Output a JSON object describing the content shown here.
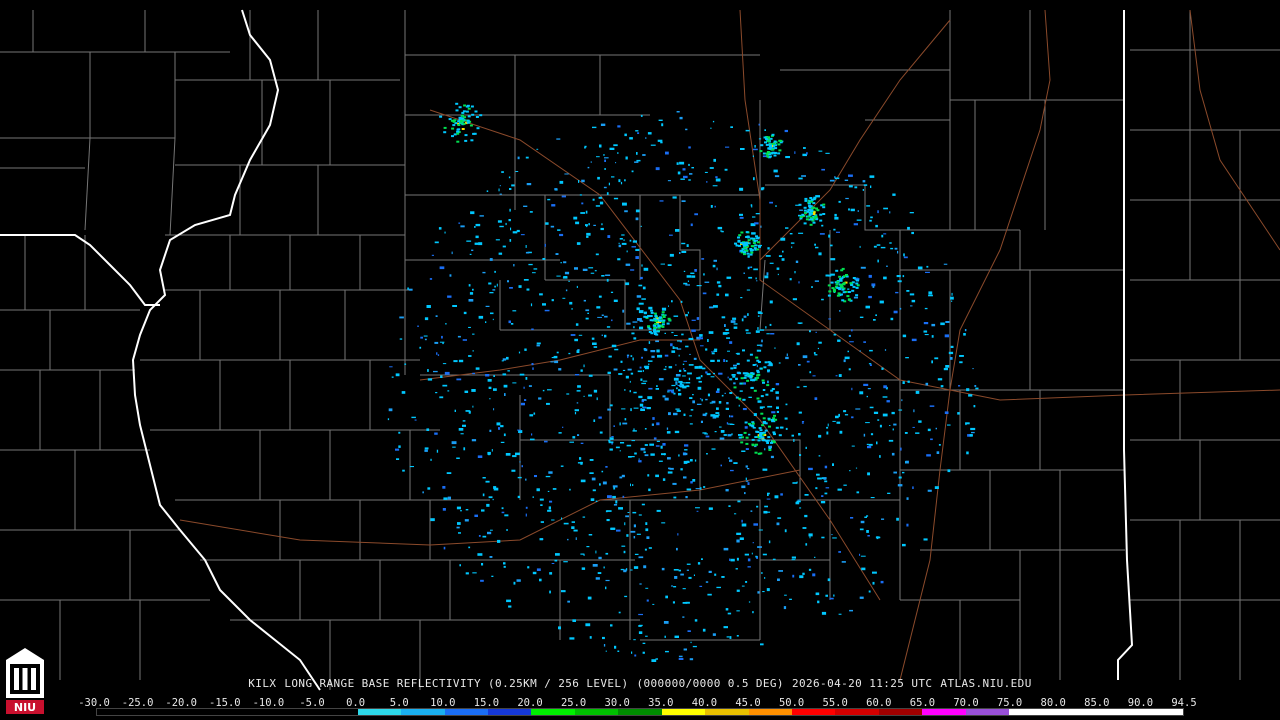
{
  "caption": {
    "station": "KILX",
    "product": "LONG RANGE BASE REFLECTIVITY (0.25KM / 256 LEVEL)",
    "volume": "(000000/0000 0.5 DEG)",
    "datetime": "2026-04-20 11:25 UTC",
    "site": "ATLAS.NIU.EDU"
  },
  "logo": {
    "text": "NIU",
    "color": "#c8102e"
  },
  "colors": {
    "background": "#000000",
    "county_lines": "#7a7a7a",
    "state_lines": "#ffffff",
    "roads": "#8b4a2b",
    "radar_low": "#00c8ff",
    "radar_mid": "#00e050",
    "radar_high": "#ffe000"
  },
  "scale": {
    "labels": [
      "-30.0",
      "-25.0",
      "-20.0",
      "-15.0",
      "-10.0",
      "-5.0",
      "0.0",
      "5.0",
      "10.0",
      "15.0",
      "20.0",
      "25.0",
      "30.0",
      "35.0",
      "40.0",
      "45.0",
      "50.0",
      "55.0",
      "60.0",
      "65.0",
      "70.0",
      "75.0",
      "80.0",
      "85.0",
      "90.0",
      "94.5"
    ],
    "colors": [
      "#000000",
      "#000000",
      "#000000",
      "#000000",
      "#000000",
      "#000000",
      "#2dd8e8",
      "#1ab0f0",
      "#1a6ef5",
      "#1538d8",
      "#00f000",
      "#00c000",
      "#008c00",
      "#ffff00",
      "#e8c000",
      "#ff9000",
      "#ff0000",
      "#d40000",
      "#a00000",
      "#ff00ff",
      "#9850d8",
      "#ffffff",
      "#ffffff",
      "#ffffff",
      "#ffffff"
    ]
  }
}
